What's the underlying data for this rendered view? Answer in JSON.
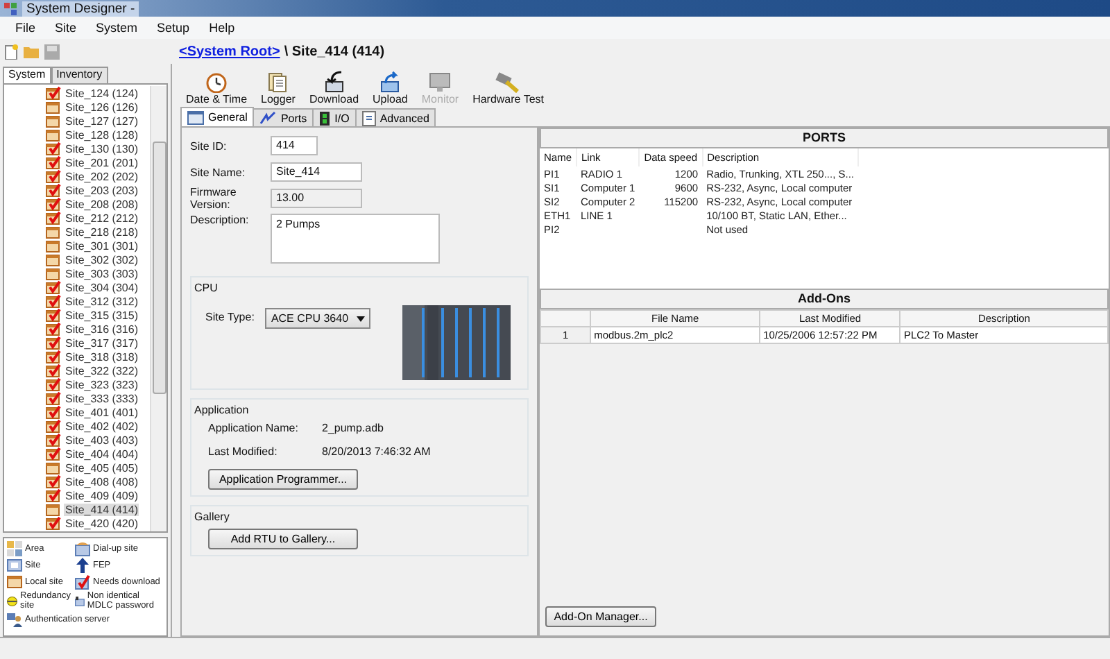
{
  "window": {
    "title": "System Designer -"
  },
  "menu": [
    "File",
    "Site",
    "System",
    "Setup",
    "Help"
  ],
  "breadcrumb": {
    "link": "<System Root>",
    "current": "\\ Site_414 (414)"
  },
  "sidebar": {
    "tabs": [
      {
        "label": "System",
        "selected": true
      },
      {
        "label": "Inventory",
        "selected": false
      }
    ],
    "tree": [
      {
        "label": "Site_124 (124)",
        "kind": "download",
        "selected": false
      },
      {
        "label": "Site_126 (126)",
        "kind": "local",
        "selected": false
      },
      {
        "label": "Site_127 (127)",
        "kind": "local",
        "selected": false
      },
      {
        "label": "Site_128 (128)",
        "kind": "local",
        "selected": false
      },
      {
        "label": "Site_130 (130)",
        "kind": "download",
        "selected": false
      },
      {
        "label": "Site_201 (201)",
        "kind": "download",
        "selected": false
      },
      {
        "label": "Site_202 (202)",
        "kind": "download",
        "selected": false
      },
      {
        "label": "Site_203 (203)",
        "kind": "download",
        "selected": false
      },
      {
        "label": "Site_208 (208)",
        "kind": "download",
        "selected": false
      },
      {
        "label": "Site_212 (212)",
        "kind": "download",
        "selected": false
      },
      {
        "label": "Site_218 (218)",
        "kind": "local",
        "selected": false
      },
      {
        "label": "Site_301 (301)",
        "kind": "local",
        "selected": false
      },
      {
        "label": "Site_302 (302)",
        "kind": "local",
        "selected": false
      },
      {
        "label": "Site_303 (303)",
        "kind": "local",
        "selected": false
      },
      {
        "label": "Site_304 (304)",
        "kind": "download",
        "selected": false
      },
      {
        "label": "Site_312 (312)",
        "kind": "download",
        "selected": false
      },
      {
        "label": "Site_315 (315)",
        "kind": "download",
        "selected": false
      },
      {
        "label": "Site_316 (316)",
        "kind": "download",
        "selected": false
      },
      {
        "label": "Site_317 (317)",
        "kind": "download",
        "selected": false
      },
      {
        "label": "Site_318 (318)",
        "kind": "download",
        "selected": false
      },
      {
        "label": "Site_322 (322)",
        "kind": "download",
        "selected": false
      },
      {
        "label": "Site_323 (323)",
        "kind": "download",
        "selected": false
      },
      {
        "label": "Site_333 (333)",
        "kind": "download",
        "selected": false
      },
      {
        "label": "Site_401 (401)",
        "kind": "download",
        "selected": false
      },
      {
        "label": "Site_402 (402)",
        "kind": "download",
        "selected": false
      },
      {
        "label": "Site_403 (403)",
        "kind": "download",
        "selected": false
      },
      {
        "label": "Site_404 (404)",
        "kind": "download",
        "selected": false
      },
      {
        "label": "Site_405 (405)",
        "kind": "local",
        "selected": false
      },
      {
        "label": "Site_408 (408)",
        "kind": "download",
        "selected": false
      },
      {
        "label": "Site_409 (409)",
        "kind": "download",
        "selected": false
      },
      {
        "label": "Site_414 (414)",
        "kind": "local",
        "selected": true
      },
      {
        "label": "Site_420 (420)",
        "kind": "download",
        "selected": false
      }
    ],
    "legend": [
      {
        "label": "Area",
        "kind": "area"
      },
      {
        "label": "Dial-up site",
        "kind": "dialup"
      },
      {
        "label": "Site",
        "kind": "site"
      },
      {
        "label": "FEP",
        "kind": "fep"
      },
      {
        "label": "Local site",
        "kind": "local"
      },
      {
        "label": "Needs download",
        "kind": "download"
      },
      {
        "label": "Redundancy site",
        "kind": "redundancy"
      },
      {
        "label": "Non identical MDLC password",
        "kind": "mdlc"
      },
      {
        "label": "Authentication server",
        "kind": "auth"
      }
    ]
  },
  "toolbar": [
    {
      "label": "Date & Time",
      "kind": "clock",
      "disabled": false
    },
    {
      "label": "Logger",
      "kind": "logger",
      "disabled": false
    },
    {
      "label": "Download",
      "kind": "download",
      "disabled": false
    },
    {
      "label": "Upload",
      "kind": "upload",
      "disabled": false
    },
    {
      "label": "Monitor",
      "kind": "monitor",
      "disabled": true
    },
    {
      "label": "Hardware Test",
      "kind": "hwtest",
      "disabled": false
    }
  ],
  "tabs": [
    {
      "label": "General",
      "kind": "general",
      "selected": true
    },
    {
      "label": "Ports",
      "kind": "ports",
      "selected": false
    },
    {
      "label": "I/O",
      "kind": "io",
      "selected": false
    },
    {
      "label": "Advanced",
      "kind": "advanced",
      "selected": false
    }
  ],
  "general": {
    "site_id": {
      "label": "Site ID:",
      "value": "414"
    },
    "site_name": {
      "label": "Site Name:",
      "value": "Site_414"
    },
    "firmware": {
      "label": "Firmware Version:",
      "value": "13.00"
    },
    "description": {
      "label": "Description:",
      "value": "2 Pumps"
    },
    "cpu": {
      "title": "CPU",
      "site_type_label": "Site Type:",
      "site_type": "ACE CPU 3640"
    },
    "application": {
      "title": "Application",
      "name_label": "Application Name:",
      "name": "2_pump.adb",
      "modified_label": "Last Modified:",
      "modified": "8/20/2013 7:46:32 AM",
      "button": "Application Programmer..."
    },
    "gallery": {
      "title": "Gallery",
      "button": "Add RTU to Gallery..."
    }
  },
  "ports": {
    "title": "PORTS",
    "columns": [
      "Name",
      "Link",
      "Data speed",
      "Description"
    ],
    "rows": [
      [
        "PI1",
        "RADIO 1",
        "1200",
        "Radio, Trunking, XTL 250..., S..."
      ],
      [
        "SI1",
        "Computer 1",
        "9600",
        "RS-232, Async, Local computer"
      ],
      [
        "SI2",
        "Computer 2",
        "115200",
        "RS-232, Async, Local computer"
      ],
      [
        "ETH1",
        "LINE 1",
        "",
        "10/100 BT, Static LAN, Ether..."
      ],
      [
        "PI2",
        "",
        "",
        "Not used"
      ]
    ]
  },
  "addons": {
    "title": "Add-Ons",
    "columns": [
      "File Name",
      "Last Modified",
      "Description"
    ],
    "rows": [
      {
        "index": "1",
        "cells": [
          "modbus.2m_plc2",
          "10/25/2006 12:57:22 PM",
          "PLC2 To Master"
        ]
      }
    ],
    "button": "Add-On Manager..."
  }
}
